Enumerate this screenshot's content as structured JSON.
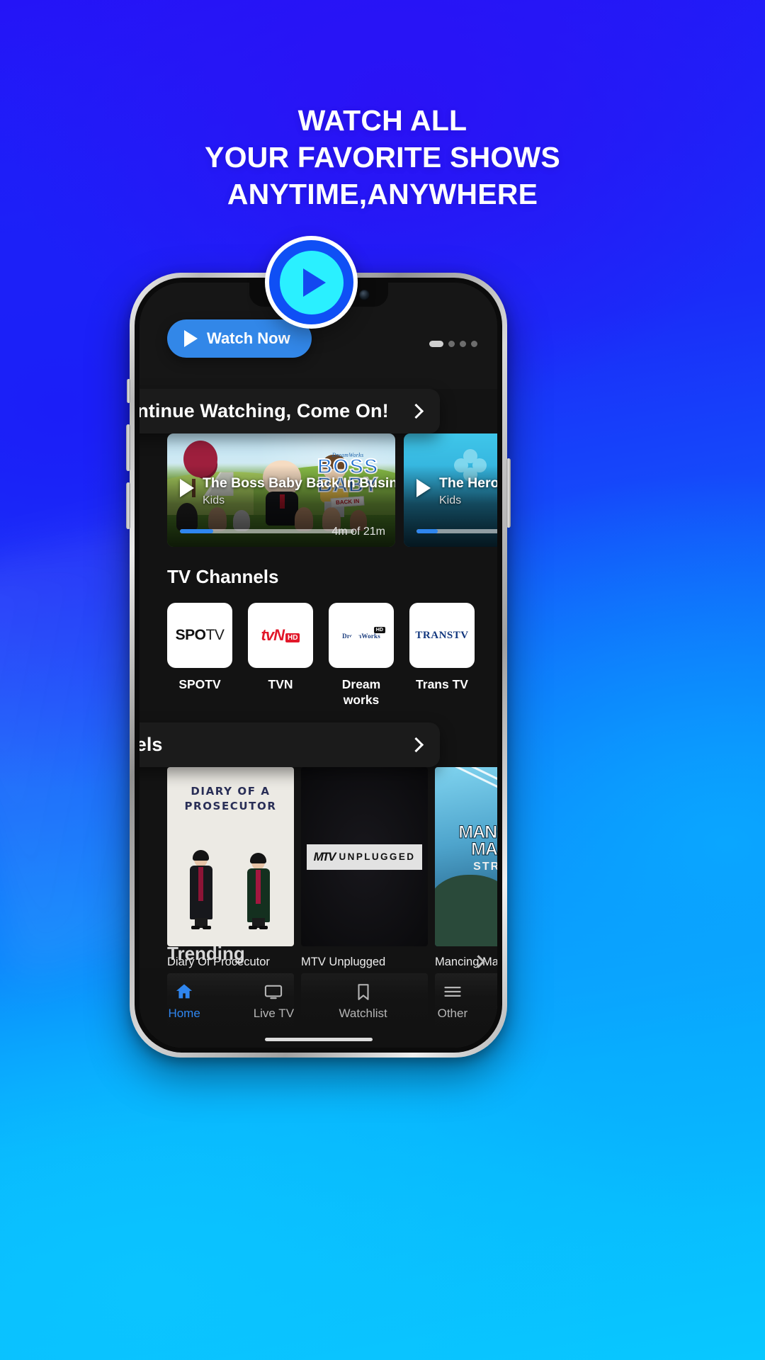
{
  "hero": {
    "headline_line1": "WATCH ALL",
    "headline_line2": "YOUR FAVORITE SHOWS",
    "headline_line3": "ANYTIME,ANYWHERE",
    "play_badge_icon": "play-icon",
    "colors": {
      "accent_blue": "#0f4ff5",
      "accent_cyan": "#2af0ff",
      "button_blue": "#3287e8",
      "background_start": "#2414f7",
      "background_end": "#08c8ff"
    }
  },
  "app": {
    "watch_now": {
      "label": "Watch Now",
      "icon": "play-icon"
    },
    "carousel_dots": [
      true,
      false,
      false,
      false
    ],
    "sections": [
      {
        "title": "Continue Watching, Come On!",
        "chevron": "chevron-right-icon"
      },
      {
        "title": "Reels",
        "chevron": "chevron-right-icon"
      }
    ],
    "continue_watching": [
      {
        "title": "The Boss Baby Back In Business",
        "category": "Kids",
        "time": "4m of 21m",
        "progress_percent": 19,
        "logo_top": "DreamWorks",
        "logo_line1": "BOSS",
        "logo_line2": "BABY",
        "logo_badge": "BACK IN"
      },
      {
        "title": "The Heroic",
        "category": "Kids",
        "time": "",
        "progress_percent": 12
      }
    ],
    "tv_channels": {
      "heading": "TV Channels",
      "items": [
        {
          "name": "SPOTV",
          "logo_main": "SPO",
          "logo_sub": "TV"
        },
        {
          "name": "TVN",
          "logo_main": "tvN",
          "logo_badge": "HD"
        },
        {
          "name": "Dream works",
          "logo_main": "DreamWorks",
          "logo_badge": "HD"
        },
        {
          "name": "Trans TV",
          "logo_main": "TRANSTV"
        }
      ]
    },
    "reels": [
      {
        "name": "Diary Of Procecutor",
        "art_line1": "DIARY OF A",
        "art_line2": "PROSECUTOR"
      },
      {
        "name": "MTV Unplugged",
        "art_logo": "MTV",
        "art_word": "UNPLUGGED"
      },
      {
        "name": "Mancing Mania",
        "art_line1": "MANCING",
        "art_line2": "MANIA",
        "art_line3": "STRIKE"
      }
    ],
    "trending": {
      "heading": "Trending",
      "chevron": "chevron-right-icon"
    },
    "bottom_nav": [
      {
        "label": "Home",
        "icon": "home-icon",
        "active": true
      },
      {
        "label": "Live TV",
        "icon": "tv-icon",
        "active": false
      },
      {
        "label": "Watchlist",
        "icon": "bookmark-icon",
        "active": false
      },
      {
        "label": "Other",
        "icon": "menu-icon",
        "active": false
      }
    ]
  }
}
